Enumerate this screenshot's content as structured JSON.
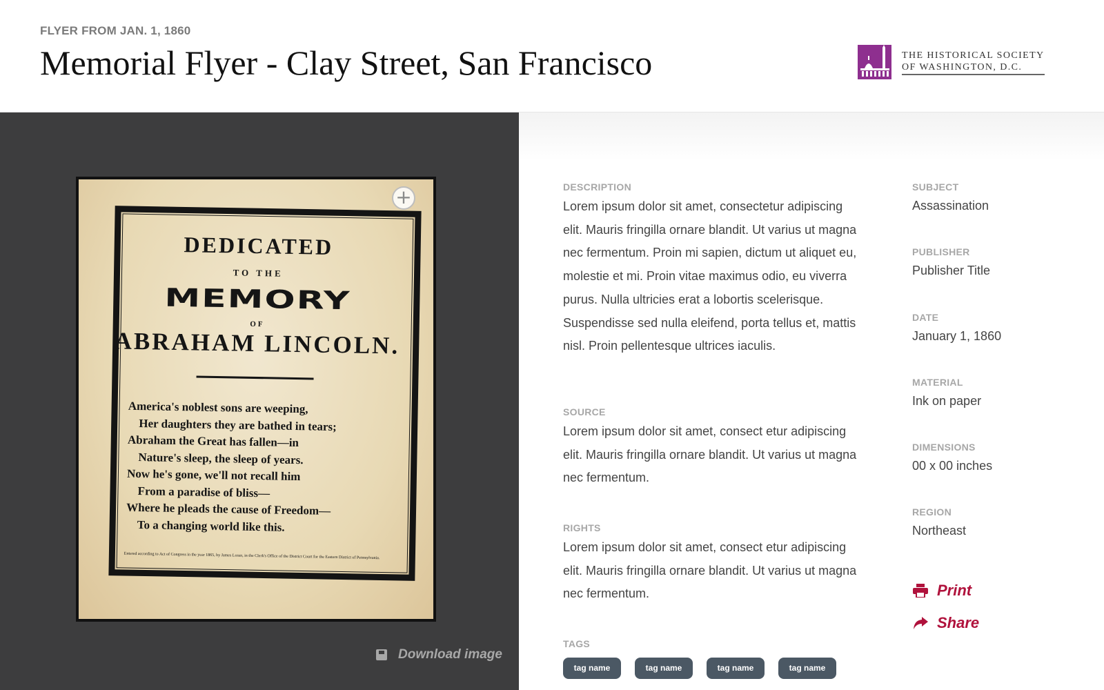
{
  "header": {
    "eyebrow": "FLYER FROM JAN. 1, 1860",
    "title": "Memorial Flyer - Clay Street, San Francisco",
    "logo_line1": "THE HISTORICAL SOCIETY",
    "logo_line2": "OF WASHINGTON, D.C."
  },
  "viewer": {
    "poster": {
      "dedicated": "DEDICATED",
      "to_the": "TO THE",
      "memory": "MEMORY",
      "of": "OF",
      "name": "ABRAHAM LINCOLN.",
      "poem": [
        "America's noblest sons are weeping,",
        "Her daughters they are bathed in tears;",
        "Abraham the Great has fallen—in",
        "Nature's sleep, the sleep of years.",
        "Now he's gone, we'll not recall him",
        "From a paradise of bliss—",
        "Where he pleads the cause of Freedom—",
        "To a changing world like this."
      ],
      "fine_print": "Entered according to Act of Congress in the year 1865, by James Lossn, in the Clerk's Office of the District Court for the Eastern District of Pennsylvania."
    },
    "zoom_icon": "plus-icon",
    "download_label": "Download image",
    "download_icon": "save-icon"
  },
  "details": {
    "description_label": "DESCRIPTION",
    "description": "Lorem ipsum dolor sit amet, consectetur adipiscing elit. Mauris fringilla ornare blandit. Ut varius ut magna nec fermentum. Proin mi sapien, dictum ut aliquet eu, molestie et mi. Proin vitae maximus odio, eu viverra purus. Nulla ultricies erat a lobortis scelerisque. Suspendisse sed nulla eleifend, porta tellus et, mattis nisl. Proin pellentesque ultrices iaculis.",
    "source_label": "SOURCE",
    "source": "Lorem ipsum dolor sit amet, consect etur adipiscing elit. Mauris fringilla ornare blandit. Ut varius ut magna nec fermentum.",
    "rights_label": "RIGHTS",
    "rights": "Lorem ipsum dolor sit amet, consect etur adipiscing elit. Mauris fringilla ornare blandit. Ut varius ut magna nec fermentum.",
    "tags_label": "TAGS",
    "tags": [
      "tag name",
      "tag name",
      "tag name",
      "tag name"
    ]
  },
  "meta": {
    "subject_label": "SUBJECT",
    "subject": "Assassination",
    "publisher_label": "PUBLISHER",
    "publisher": "Publisher Title",
    "date_label": "DATE",
    "date": "January 1, 1860",
    "material_label": "MATERIAL",
    "material": "Ink on paper",
    "dimensions_label": "DIMENSIONS",
    "dimensions": "00 x 00 inches",
    "region_label": "REGION",
    "region": "Northeast"
  },
  "actions": {
    "print_label": "Print",
    "print_icon": "printer-icon",
    "share_label": "Share",
    "share_icon": "share-arrow-icon"
  },
  "colors": {
    "accent": "#b0123c",
    "logo_purple": "#8e2f8f",
    "tag_bg": "#4b5864",
    "viewer_bg": "#3d3d3e"
  }
}
